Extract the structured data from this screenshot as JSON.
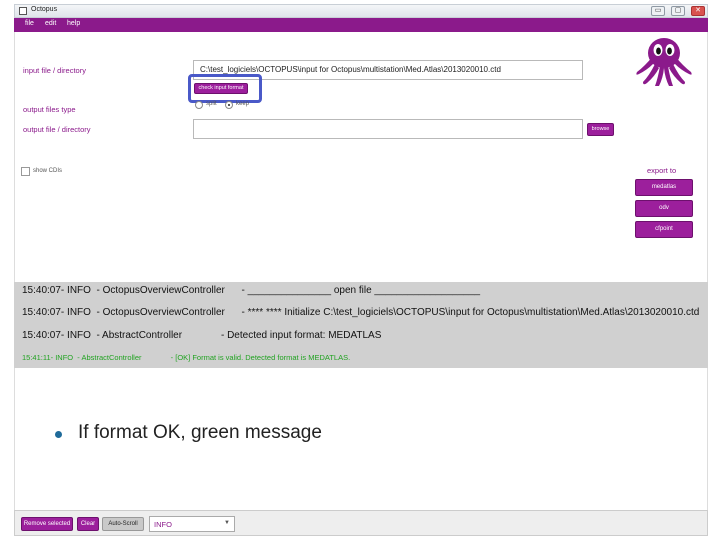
{
  "window": {
    "title": "Octopus",
    "buttons": {
      "minimize": "▭",
      "maximize": "▢",
      "close": "✕"
    }
  },
  "menu": {
    "file": "file",
    "edit": "edit",
    "help": "help"
  },
  "form": {
    "input_label": "input file / directory",
    "input_value": "C:\\test_logiciels\\OCTOPUS\\input for Octopus\\multistation\\Med.Atlas\\2013020010.ctd",
    "check_button": "check input format",
    "output_type_label": "output files type",
    "radio_split": "split",
    "radio_keep": "keep",
    "output_label": "output file / directory",
    "output_value": "",
    "browse_button": "browse",
    "show_cdis": "show CDIs"
  },
  "export": {
    "label": "export to",
    "buttons": [
      "medatlas",
      "odv",
      "cfpoint"
    ]
  },
  "log": {
    "lines": [
      "15:40:07- INFO  - OctopusOverviewController      - _______________ open file ___________________",
      "15:40:07- INFO  - OctopusOverviewController      - **** **** Initialize C:\\test_logiciels\\OCTOPUS\\input for Octopus\\multistation\\Med.Atlas\\2013020010.ctd",
      "15:40:07- INFO  - AbstractController              - Detected input format: MEDATLAS"
    ],
    "green_line": "15:41:11- INFO  - AbstractController              - [OK] Format is valid. Detected format is MEDATLAS."
  },
  "slide": {
    "bullet": "If format OK, green message"
  },
  "bottom": {
    "remove_selected": "Remove selected",
    "clear": "Clear",
    "auto_scroll": "Auto-Scroll",
    "level": "INFO"
  },
  "colors": {
    "accent": "#9c1f9c",
    "menu": "#8b1a8b",
    "ok_green": "#22a322",
    "highlight": "#4a59c8"
  },
  "icons": {
    "mascot": "octopus-logo-icon",
    "dropdown": "chevron-down-icon"
  }
}
